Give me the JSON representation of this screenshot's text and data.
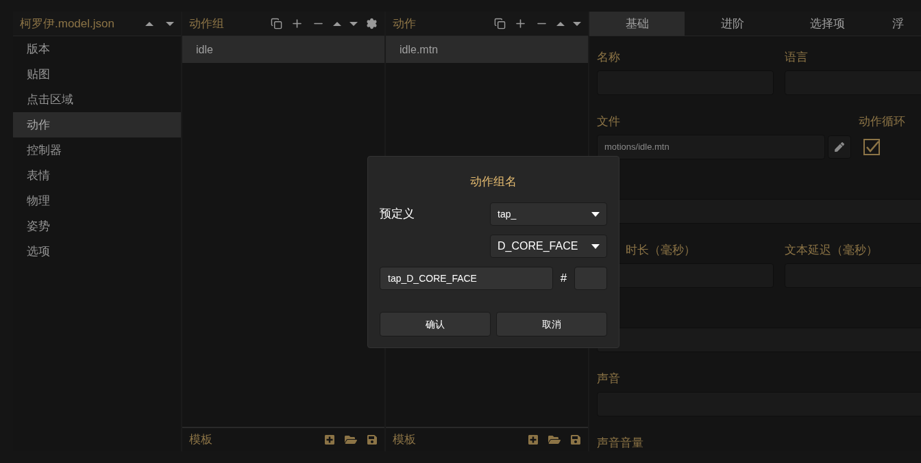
{
  "sidebar": {
    "title": "柯罗伊.model.json",
    "items": [
      {
        "label": "版本",
        "selected": false
      },
      {
        "label": "贴图",
        "selected": false
      },
      {
        "label": "点击区域",
        "selected": false
      },
      {
        "label": "动作",
        "selected": true
      },
      {
        "label": "控制器",
        "selected": false
      },
      {
        "label": "表情",
        "selected": false
      },
      {
        "label": "物理",
        "selected": false
      },
      {
        "label": "姿势",
        "selected": false
      },
      {
        "label": "选项",
        "selected": false
      }
    ]
  },
  "panels": [
    {
      "title": "动作组",
      "settings": true,
      "items": [
        {
          "label": "idle",
          "selected": true
        }
      ],
      "footer": "模板"
    },
    {
      "title": "动作",
      "settings": false,
      "items": [
        {
          "label": "idle.mtn",
          "selected": true
        }
      ],
      "footer": "模板"
    }
  ],
  "tabs": [
    {
      "label": "基础",
      "selected": true
    },
    {
      "label": "进阶",
      "selected": false
    },
    {
      "label": "选择项",
      "selected": false
    },
    {
      "label": "浮",
      "selected": false
    }
  ],
  "form": [
    {
      "kind": "pair",
      "fields": [
        {
          "label": "名称"
        },
        {
          "label": "语言"
        }
      ]
    },
    {
      "kind": "file",
      "label": "文件",
      "value": "motions/idle.mtn",
      "loop_label": "动作循环",
      "loop_checked": true
    },
    {
      "kind": "single"
    },
    {
      "kind": "pair",
      "fields": [
        {
          "label": "时长（毫秒）",
          "clipped": true
        },
        {
          "label": "文本延迟（毫秒）"
        }
      ]
    },
    {
      "kind": "single"
    },
    {
      "kind": "single",
      "label": "声音"
    },
    {
      "kind": "label",
      "label": "声音音量"
    }
  ],
  "dialog": {
    "title": "动作组名",
    "predefined_label": "预定义",
    "select_1": "tap_",
    "select_2": "D_CORE_FACE",
    "name_value": "tap_D_CORE_FACE",
    "hash": "#",
    "confirm": "确认",
    "cancel": "取消"
  }
}
